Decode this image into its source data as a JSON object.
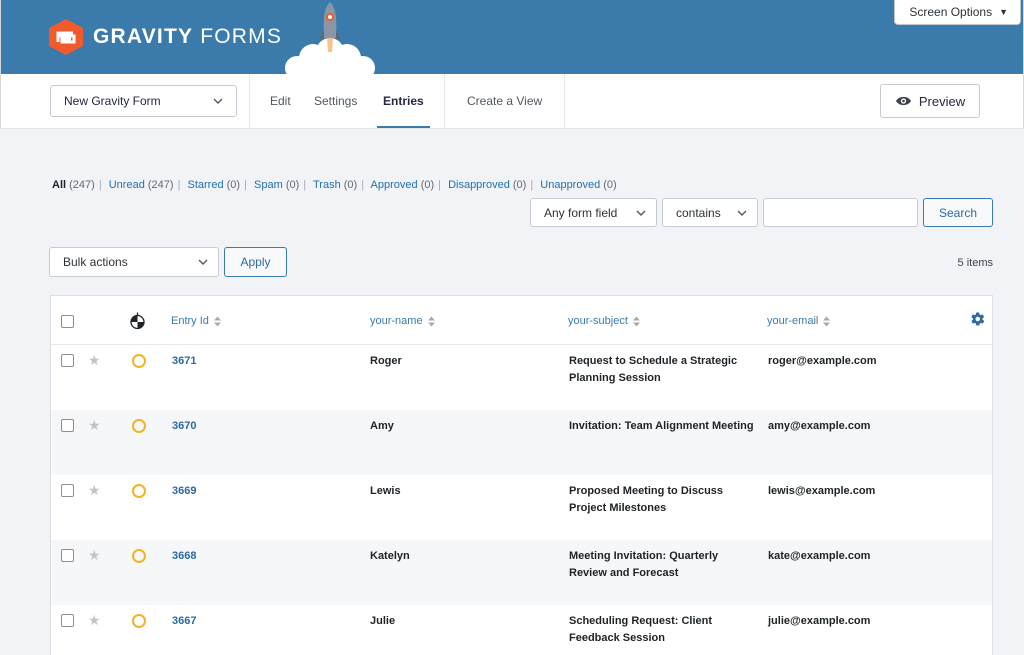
{
  "app": {
    "logo_bold": "GRAVITY",
    "logo_light": "FORMS",
    "screen_options": "Screen Options"
  },
  "toolbar": {
    "form_name": "New Gravity Form",
    "tabs": [
      {
        "label": "Edit"
      },
      {
        "label": "Settings"
      },
      {
        "label": "Entries",
        "active": true
      },
      {
        "label": "Create a View"
      }
    ],
    "preview": "Preview"
  },
  "filters": [
    {
      "label": "All",
      "count": "(247)",
      "current": true
    },
    {
      "label": "Unread",
      "count": "(247)"
    },
    {
      "label": "Starred",
      "count": "(0)"
    },
    {
      "label": "Spam",
      "count": "(0)"
    },
    {
      "label": "Trash",
      "count": "(0)"
    },
    {
      "label": "Approved",
      "count": "(0)"
    },
    {
      "label": "Disapproved",
      "count": "(0)"
    },
    {
      "label": "Unapproved",
      "count": "(0)"
    }
  ],
  "search": {
    "field": "Any form field",
    "operator": "contains",
    "value": "",
    "button": "Search"
  },
  "bulk": {
    "label": "Bulk actions",
    "apply": "Apply"
  },
  "items_count": "5 items",
  "table": {
    "columns": [
      "Entry Id",
      "your-name",
      "your-subject",
      "your-email"
    ],
    "rows": [
      {
        "id": "3671",
        "name": "Roger",
        "subject": "Request to Schedule a Strategic Planning Session",
        "email": "roger@example.com"
      },
      {
        "id": "3670",
        "name": "Amy",
        "subject": "Invitation: Team Alignment Meeting",
        "email": "amy@example.com"
      },
      {
        "id": "3669",
        "name": "Lewis",
        "subject": "Proposed Meeting to Discuss Project Milestones",
        "email": "lewis@example.com"
      },
      {
        "id": "3668",
        "name": "Katelyn",
        "subject": "Meeting Invitation: Quarterly Review and Forecast",
        "email": "kate@example.com"
      },
      {
        "id": "3667",
        "name": "Julie",
        "subject": "Scheduling Request: Client Feedback Session",
        "email": "julie@example.com"
      }
    ]
  },
  "colors": {
    "header_bg": "#3b7bab",
    "logo_orange": "#f15a2b",
    "link": "#2271b1",
    "unread_ring": "#f0b429"
  },
  "icons": {
    "logo": "gravity-forms-logo-icon",
    "rocket": "rocket-icon",
    "preview": "eye-icon",
    "settings": "gear-icon",
    "star": "star-icon",
    "unread": "unread-circle-icon"
  }
}
